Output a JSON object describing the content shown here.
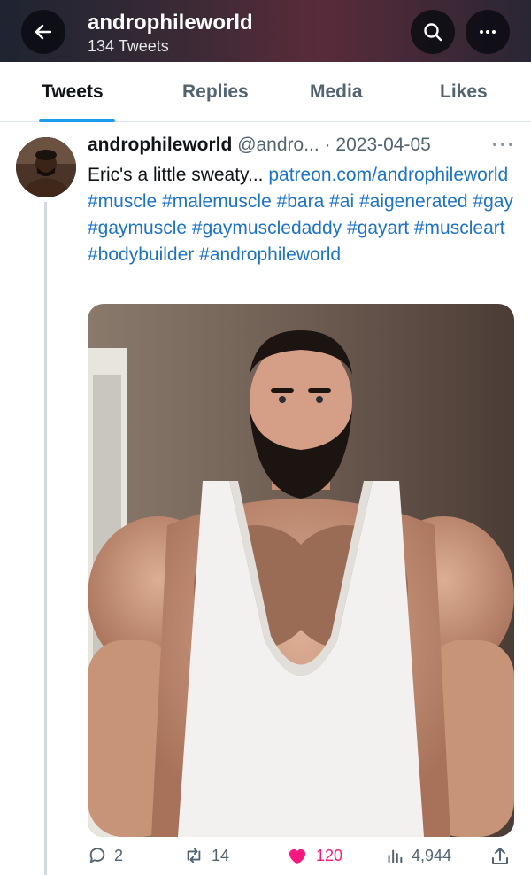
{
  "header": {
    "title": "androphileworld",
    "subtitle": "134 Tweets",
    "back_icon": "arrow-left-icon",
    "search_icon": "search-icon",
    "more_icon": "more-horizontal-icon"
  },
  "tabs": [
    {
      "label": "Tweets",
      "active": true
    },
    {
      "label": "Replies",
      "active": false
    },
    {
      "label": "Media",
      "active": false
    },
    {
      "label": "Likes",
      "active": false
    }
  ],
  "tweet": {
    "display_name": "androphileworld",
    "handle": "@andro...",
    "separator": "·",
    "date": "2023-04-05",
    "text_plain": "Eric's a little sweaty...",
    "text_link": "patreon.com/androphileworld",
    "hashtags": "#muscle #malemuscle #bara #ai #aigenerated #gay #gaymuscle #gaymuscledaddy #gayart #muscleart #bodybuilder #androphileworld",
    "actions": {
      "replies": "2",
      "retweets": "14",
      "likes": "120",
      "views": "4,944"
    }
  },
  "colors": {
    "accent": "#1d9bf0",
    "link": "#1d73c4",
    "like": "#f91880",
    "muted": "#536471"
  }
}
